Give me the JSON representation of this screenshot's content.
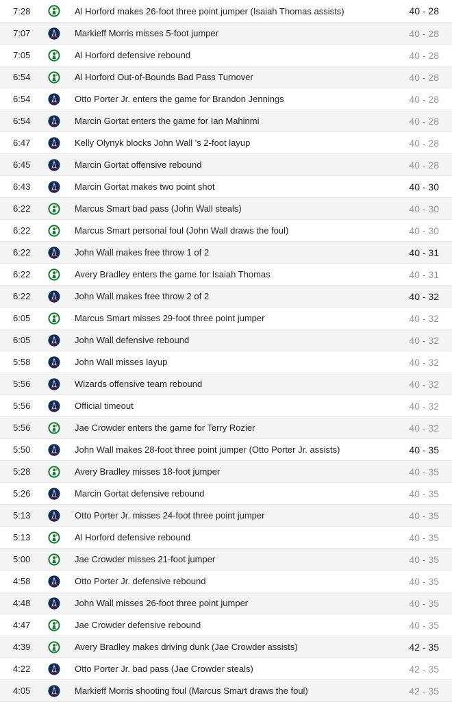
{
  "colors": {
    "celtics_green": "#1a7a3c",
    "wizards_navy": "#0c2c56",
    "wizards_red": "#d01f2f",
    "score_changed": "#222222",
    "score_unchanged": "#9a9a9a"
  },
  "icons": {
    "celtics": "celtics-logo-icon",
    "wizards": "wizards-logo-icon"
  },
  "plays": [
    {
      "time": "7:28",
      "team": "celtics",
      "desc": "Al Horford makes 26-foot three point jumper (Isaiah Thomas assists)",
      "score": "40 - 28",
      "changed": true
    },
    {
      "time": "7:07",
      "team": "wizards",
      "desc": "Markieff Morris misses 5-foot jumper",
      "score": "40 - 28",
      "changed": false
    },
    {
      "time": "7:05",
      "team": "celtics",
      "desc": "Al Horford defensive rebound",
      "score": "40 - 28",
      "changed": false
    },
    {
      "time": "6:54",
      "team": "celtics",
      "desc": "Al Horford Out-of-Bounds Bad Pass Turnover",
      "score": "40 - 28",
      "changed": false
    },
    {
      "time": "6:54",
      "team": "wizards",
      "desc": "Otto Porter Jr. enters the game for Brandon Jennings",
      "score": "40 - 28",
      "changed": false
    },
    {
      "time": "6:54",
      "team": "wizards",
      "desc": "Marcin Gortat enters the game for Ian Mahinmi",
      "score": "40 - 28",
      "changed": false
    },
    {
      "time": "6:47",
      "team": "wizards",
      "desc": "Kelly Olynyk blocks John Wall 's 2-foot layup",
      "score": "40 - 28",
      "changed": false
    },
    {
      "time": "6:45",
      "team": "wizards",
      "desc": "Marcin Gortat offensive rebound",
      "score": "40 - 28",
      "changed": false
    },
    {
      "time": "6:43",
      "team": "wizards",
      "desc": "Marcin Gortat makes two point shot",
      "score": "40 - 30",
      "changed": true
    },
    {
      "time": "6:22",
      "team": "celtics",
      "desc": "Marcus Smart bad pass (John Wall steals)",
      "score": "40 - 30",
      "changed": false
    },
    {
      "time": "6:22",
      "team": "celtics",
      "desc": "Marcus Smart personal foul (John Wall draws the foul)",
      "score": "40 - 30",
      "changed": false
    },
    {
      "time": "6:22",
      "team": "wizards",
      "desc": "John Wall makes free throw 1 of 2",
      "score": "40 - 31",
      "changed": true
    },
    {
      "time": "6:22",
      "team": "celtics",
      "desc": "Avery Bradley enters the game for Isaiah Thomas",
      "score": "40 - 31",
      "changed": false
    },
    {
      "time": "6:22",
      "team": "wizards",
      "desc": "John Wall makes free throw 2 of 2",
      "score": "40 - 32",
      "changed": true
    },
    {
      "time": "6:05",
      "team": "celtics",
      "desc": "Marcus Smart misses 29-foot three point jumper",
      "score": "40 - 32",
      "changed": false
    },
    {
      "time": "6:05",
      "team": "wizards",
      "desc": "John Wall defensive rebound",
      "score": "40 - 32",
      "changed": false
    },
    {
      "time": "5:58",
      "team": "wizards",
      "desc": "John Wall misses layup",
      "score": "40 - 32",
      "changed": false
    },
    {
      "time": "5:56",
      "team": "wizards",
      "desc": "Wizards offensive team rebound",
      "score": "40 - 32",
      "changed": false
    },
    {
      "time": "5:56",
      "team": "wizards",
      "desc": "Official timeout",
      "score": "40 - 32",
      "changed": false
    },
    {
      "time": "5:56",
      "team": "celtics",
      "desc": "Jae Crowder enters the game for Terry Rozier",
      "score": "40 - 32",
      "changed": false
    },
    {
      "time": "5:50",
      "team": "wizards",
      "desc": "John Wall makes 28-foot three point jumper (Otto Porter Jr. assists)",
      "score": "40 - 35",
      "changed": true
    },
    {
      "time": "5:28",
      "team": "celtics",
      "desc": "Avery Bradley misses 18-foot jumper",
      "score": "40 - 35",
      "changed": false
    },
    {
      "time": "5:26",
      "team": "wizards",
      "desc": "Marcin Gortat defensive rebound",
      "score": "40 - 35",
      "changed": false
    },
    {
      "time": "5:13",
      "team": "wizards",
      "desc": "Otto Porter Jr. misses 24-foot three point jumper",
      "score": "40 - 35",
      "changed": false
    },
    {
      "time": "5:13",
      "team": "celtics",
      "desc": "Al Horford defensive rebound",
      "score": "40 - 35",
      "changed": false
    },
    {
      "time": "5:00",
      "team": "celtics",
      "desc": "Jae Crowder misses 21-foot jumper",
      "score": "40 - 35",
      "changed": false
    },
    {
      "time": "4:58",
      "team": "wizards",
      "desc": "Otto Porter Jr. defensive rebound",
      "score": "40 - 35",
      "changed": false
    },
    {
      "time": "4:48",
      "team": "wizards",
      "desc": "John Wall misses 26-foot three point jumper",
      "score": "40 - 35",
      "changed": false
    },
    {
      "time": "4:47",
      "team": "celtics",
      "desc": "Jae Crowder defensive rebound",
      "score": "40 - 35",
      "changed": false
    },
    {
      "time": "4:39",
      "team": "celtics",
      "desc": "Avery Bradley makes driving dunk (Jae Crowder assists)",
      "score": "42 - 35",
      "changed": true
    },
    {
      "time": "4:22",
      "team": "wizards",
      "desc": "Otto Porter Jr. bad pass (Jae Crowder steals)",
      "score": "42 - 35",
      "changed": false
    },
    {
      "time": "4:05",
      "team": "wizards",
      "desc": "Markieff Morris shooting foul (Marcus Smart draws the foul)",
      "score": "42 - 35",
      "changed": false
    }
  ]
}
